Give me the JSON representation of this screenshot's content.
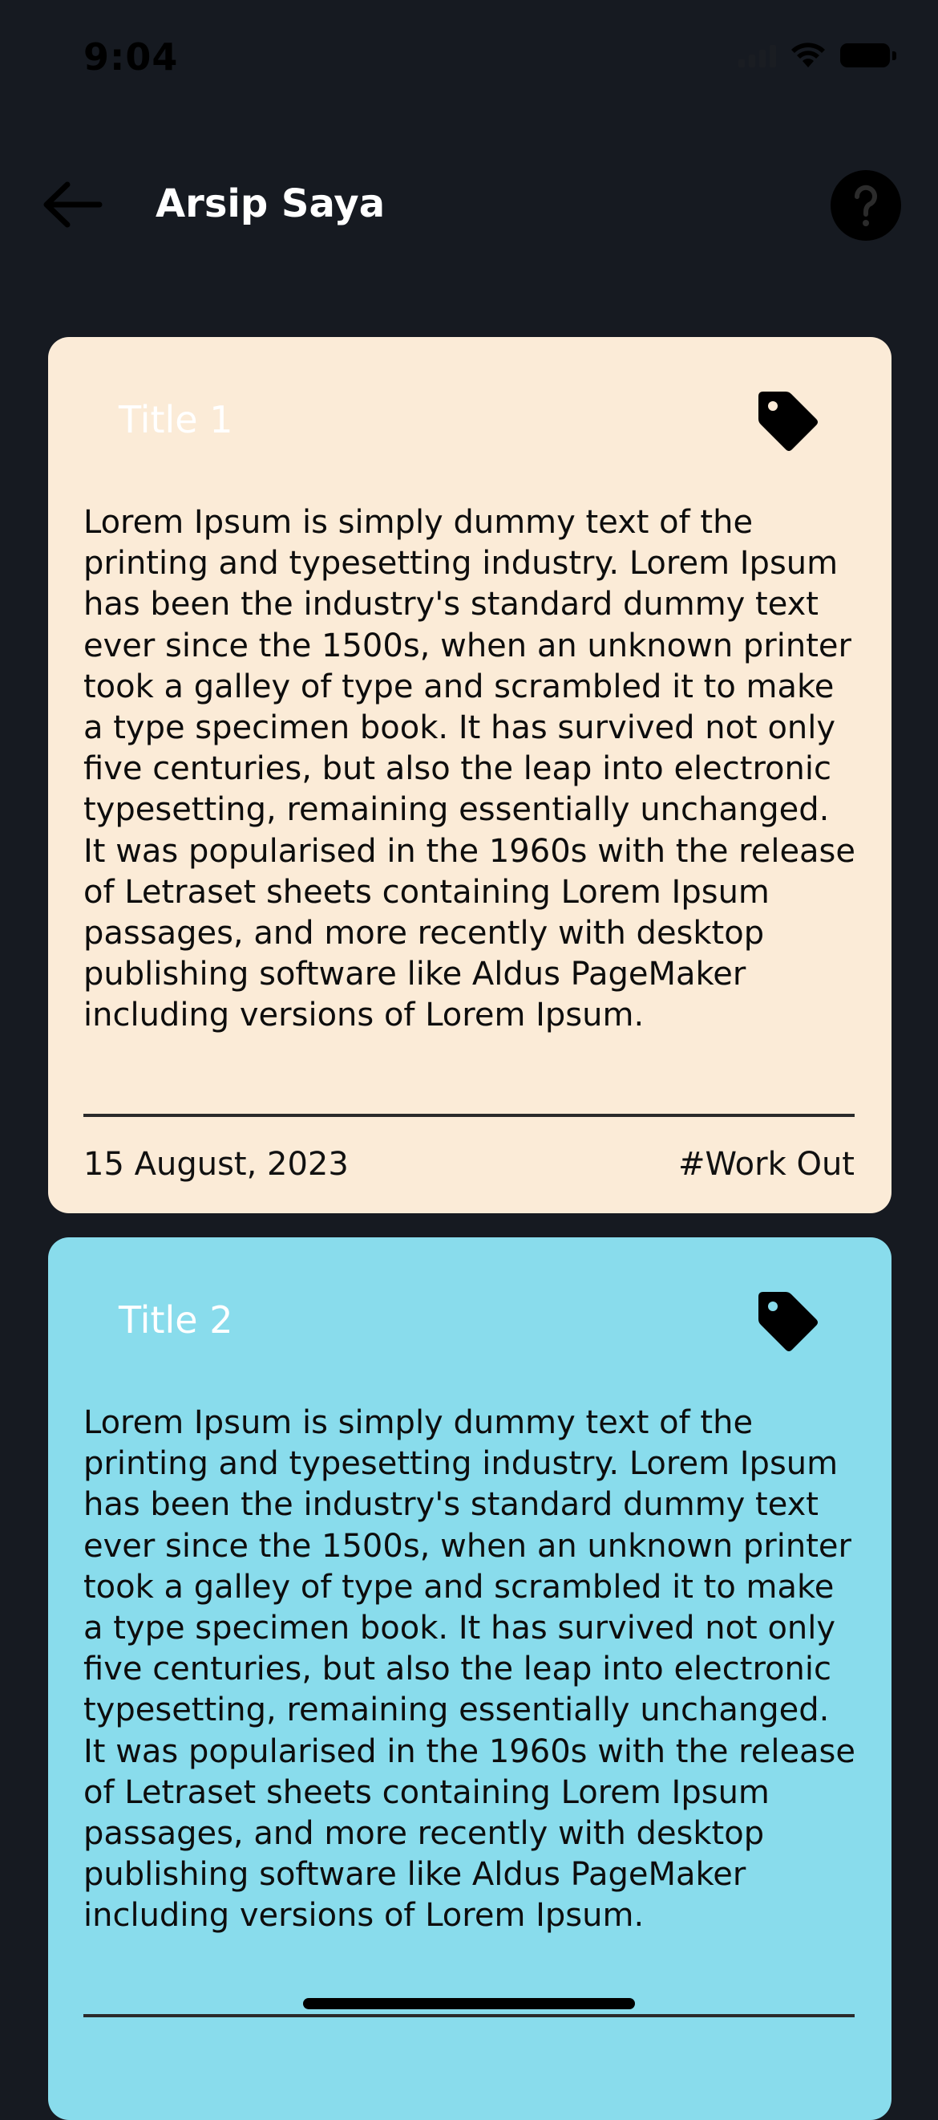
{
  "status_bar": {
    "time": "9:04",
    "icons": [
      "signal-icon",
      "wifi-icon",
      "battery-icon"
    ]
  },
  "header": {
    "title": "Arsip Saya",
    "back_icon": "arrow-left-icon",
    "help_icon": "question-mark-icon"
  },
  "notes": [
    {
      "title": "Title 1",
      "body": "Lorem Ipsum is simply dummy text of the printing and typesetting industry. Lorem Ipsum has been the industry's standard dummy text ever since the 1500s, when an unknown printer took a galley of type and scrambled it to make a type specimen book. It has survived not only five centuries, but also the leap into electronic typesetting, remaining essentially unchanged. It was popularised in the 1960s with the release of Letraset sheets containing Lorem Ipsum passages, and more recently with desktop publishing software like Aldus PageMaker including versions of Lorem Ipsum.",
      "date": "15 August, 2023",
      "tag": "#Work Out",
      "color": "#fbebd7"
    },
    {
      "title": "Title 2",
      "body": "Lorem Ipsum is simply dummy text of the printing and typesetting industry. Lorem Ipsum has been the industry's standard dummy text ever since the 1500s, when an unknown printer took a galley of type and scrambled it to make a type specimen book. It has survived not only five centuries, but also the leap into electronic typesetting, remaining essentially unchanged. It was popularised in the 1960s with the release of Letraset sheets containing Lorem Ipsum passages, and more recently with desktop publishing software like Aldus PageMaker including versions of Lorem Ipsum.",
      "color": "#89dcec"
    }
  ],
  "colors": {
    "background": "#161a21",
    "title_text": "#ffffff"
  }
}
